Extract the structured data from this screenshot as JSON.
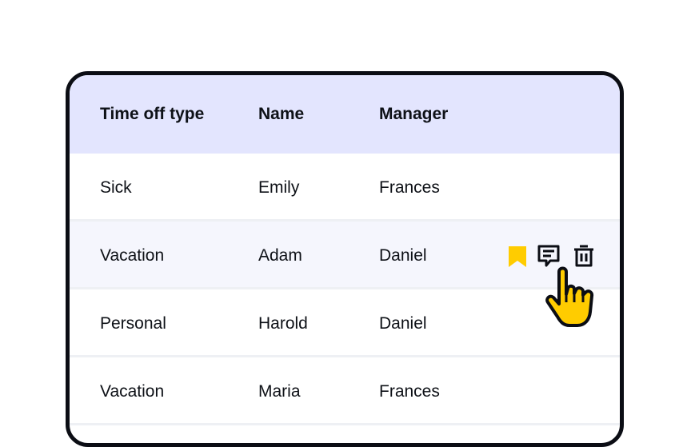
{
  "table": {
    "columns": [
      "Time off type",
      "Name",
      "Manager"
    ],
    "rows": [
      {
        "type": "Sick",
        "name": "Emily",
        "manager": "Frances"
      },
      {
        "type": "Vacation",
        "name": "Adam",
        "manager": "Daniel"
      },
      {
        "type": "Personal",
        "name": "Harold",
        "manager": "Daniel"
      },
      {
        "type": "Vacation",
        "name": "Maria",
        "manager": "Frances"
      }
    ]
  },
  "row_actions": {
    "icons": [
      "bookmark-icon",
      "comment-icon",
      "trash-icon"
    ],
    "accent_color": "#ffcc00"
  },
  "colors": {
    "header_bg": "#e3e5fe",
    "highlight_row_bg": "#f5f6fd",
    "border": "#0b0d14",
    "cursor_fill": "#ffcc00"
  }
}
